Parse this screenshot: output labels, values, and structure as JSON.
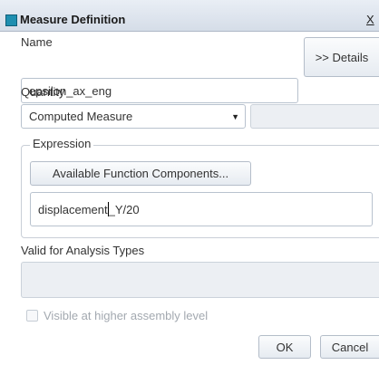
{
  "window": {
    "title": "Measure Definition",
    "close_label": "X"
  },
  "name": {
    "label": "Name",
    "value": "epsilon_ax_eng",
    "details_button": ">> Details"
  },
  "quantity": {
    "label": "Quantity",
    "selected": "Computed Measure"
  },
  "expression": {
    "legend": "Expression",
    "functions_button": "Available Function Components...",
    "value_before_caret": "displacement",
    "value_after_caret": "_Y/20"
  },
  "analysis_types": {
    "label": "Valid for Analysis Types"
  },
  "visible_checkbox": {
    "label": "Visible at higher assembly level",
    "checked": false
  },
  "footer": {
    "ok_label": "OK",
    "cancel_label": "Cancel"
  },
  "colors": {
    "title_icon": "#1f8fb0",
    "disabled_text": "#a3a9b0"
  },
  "icons": {
    "title": "window-app-icon",
    "dropdown": "dropdown-arrow-icon"
  }
}
